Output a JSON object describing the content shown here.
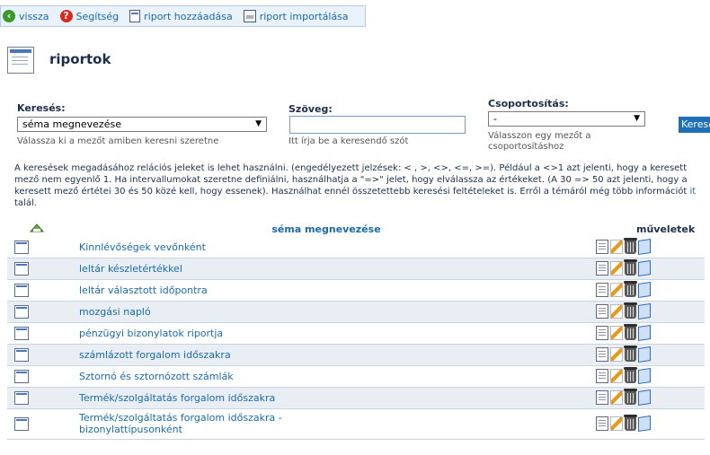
{
  "toolbar": {
    "back": "vissza",
    "help": "Segítség",
    "add_report": "riport hozzáadása",
    "import_report": "riport importálása"
  },
  "page": {
    "title": "riportok"
  },
  "search": {
    "field_label": "Keresés:",
    "field_value": "séma megnevezése",
    "field_hint": "Válassza ki a mezőt amiben keresni szeretne",
    "text_label": "Szöveg:",
    "text_value": "",
    "text_hint": "Itt írja be a keresendő szót",
    "group_label": "Csoportosítás:",
    "group_value": "-",
    "group_hint_line1": "Válasszon egy mezőt a",
    "group_hint_line2": "csoportosításhoz",
    "button": "Keresés"
  },
  "info": {
    "text": "A keresések megadásához relációs jeleket is lehet használni. (engedélyezett jelzések: < , >, <>, <=, >=). Például a <>1 azt jelenti, hogy a keresett mező nem egyenlő 1. Ha intervallumokat szeretne definiálni, használhatja a \"=>\" jelet, hogy elválassza az értékeket. (A 30 => 50 azt jelenti, hogy a keresett mező értétei 30 és 50 közé kell, hogy essenek). Használhat ennél összetettebb keresési feltételeket is. Erről a témáról még több információt ",
    "link": "it",
    "link_tail": "talál."
  },
  "table": {
    "col_name": "séma megnevezése",
    "col_ops": "műveletek",
    "rows": [
      {
        "name": "Kinnlévőségek vevőnként"
      },
      {
        "name": "leltár készletértékkel"
      },
      {
        "name": "leltár választott időpontra"
      },
      {
        "name": "mozgási napló"
      },
      {
        "name": "pénzügyi bizonylatok riportja"
      },
      {
        "name": "számlázott forgalom időszakra"
      },
      {
        "name": "Sztornó és sztornózott számlák"
      },
      {
        "name": "Termék/szolgáltatás forgalom időszakra"
      },
      {
        "name_line1": "Termék/szolgáltatás forgalom időszakra -",
        "name_line2": "bizonylattípusonként"
      }
    ]
  }
}
